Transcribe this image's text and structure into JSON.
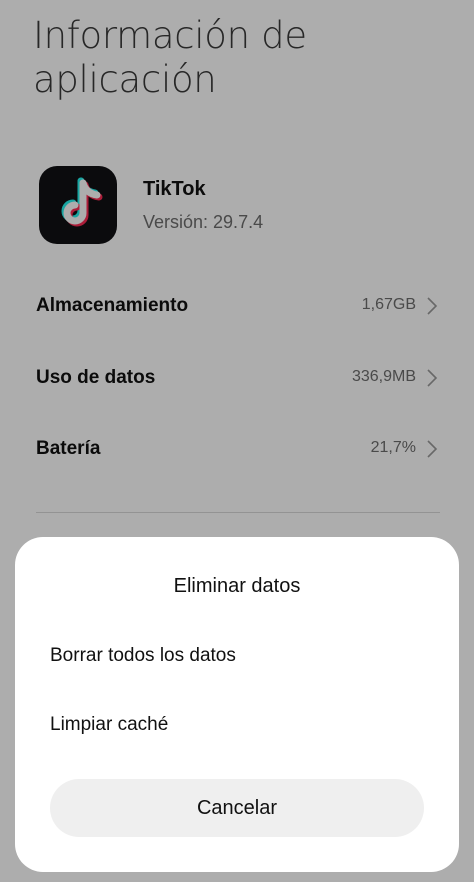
{
  "header": {
    "title": "Información de aplicación"
  },
  "app": {
    "name": "TikTok",
    "version": "Versión: 29.7.4",
    "icon": "tiktok-logo"
  },
  "rows": [
    {
      "label": "Almacenamiento",
      "value": "1,67GB",
      "icon": "chevron-right-icon"
    },
    {
      "label": "Uso de datos",
      "value": "336,9MB",
      "icon": "chevron-right-icon"
    },
    {
      "label": "Batería",
      "value": "21,7%",
      "icon": "chevron-right-icon"
    }
  ],
  "dialog": {
    "title": "Eliminar datos",
    "options": [
      {
        "label": "Borrar todos los datos"
      },
      {
        "label": "Limpiar caché"
      }
    ],
    "cancel_label": "Cancelar"
  },
  "colors": {
    "overlay": "#000000",
    "sheet_background": "#ffffff",
    "cancel_button_background": "#efefef",
    "app_icon_background": "#111114",
    "tiktok_cyan": "#25f4ee",
    "tiktok_pink": "#fe2c55"
  }
}
